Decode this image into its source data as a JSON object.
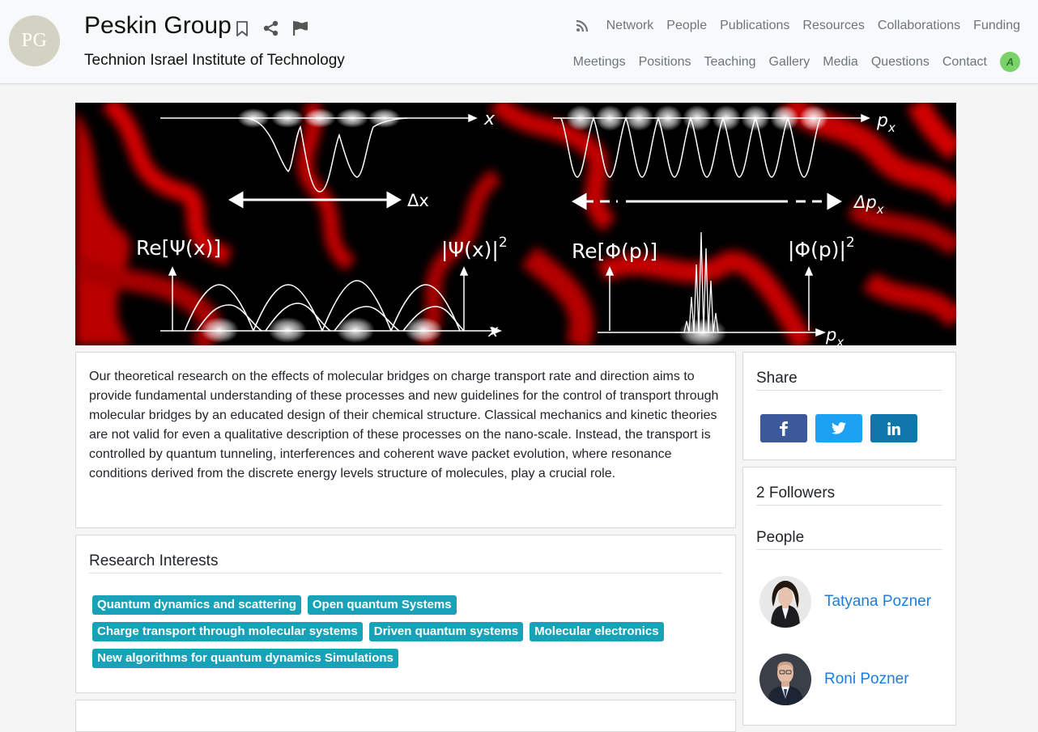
{
  "header": {
    "avatar_initials": "PG",
    "title": "Peskin Group",
    "institution": "Technion Israel Institute of Technology",
    "title_icons": [
      "bookmark-icon",
      "share-icon",
      "flag-icon"
    ],
    "nav_row1": [
      "Network",
      "People",
      "Publications",
      "Resources",
      "Collaborations",
      "Funding"
    ],
    "nav_row2": [
      "Meetings",
      "Positions",
      "Teaching",
      "Gallery",
      "Media",
      "Questions",
      "Contact"
    ],
    "user_avatar_letter": "A"
  },
  "banner": {
    "labels": {
      "x_top": "x",
      "px_top": "p",
      "px_sub": "x",
      "dx": "Δx",
      "dpx": "Δp",
      "re_psi": "Re[Ψ(x)]",
      "abs_psi": "|Ψ(x)|",
      "re_phi": "Re[Φ(p)]",
      "abs_phi": "|Φ(p)|",
      "sq": "2",
      "x_bottom": "x",
      "px_bottom": "p"
    }
  },
  "about": {
    "text": "Our theoretical research on the effects of molecular bridges on charge transport rate and direction aims to provide fundamental understanding of these processes and new guidelines for the control of transport through molecular bridges by an educated design of their chemical structure. Classical mechanics and kinetic theories are not valid for even a qualitative description of these processes on the nano-scale. Instead, the transport is controlled by quantum tunneling, interferences and coherent wave packet evolution, where resonance conditions derived from the discrete energy levels structure of molecules, play a crucial role."
  },
  "research_interests": {
    "heading": "Research Interests",
    "tags": [
      "Quantum dynamics and scattering",
      "Open quantum Systems",
      "Charge transport through molecular systems",
      "Driven quantum systems",
      "Molecular electronics",
      "New algorithms for quantum dynamics Simulations"
    ]
  },
  "share": {
    "heading": "Share",
    "buttons": [
      "facebook-icon",
      "twitter-icon",
      "linkedin-icon"
    ],
    "colors": {
      "facebook": "#3b5998",
      "twitter": "#1da1f2",
      "linkedin": "#0e76a8"
    }
  },
  "followers": {
    "heading": "2 Followers",
    "people_heading": "People",
    "people": [
      "Tatyana Pozner",
      "Roni Pozner"
    ]
  },
  "colors": {
    "tag": "#17a2b8",
    "link": "#1a7ee0",
    "nav_text": "#6c757d"
  }
}
